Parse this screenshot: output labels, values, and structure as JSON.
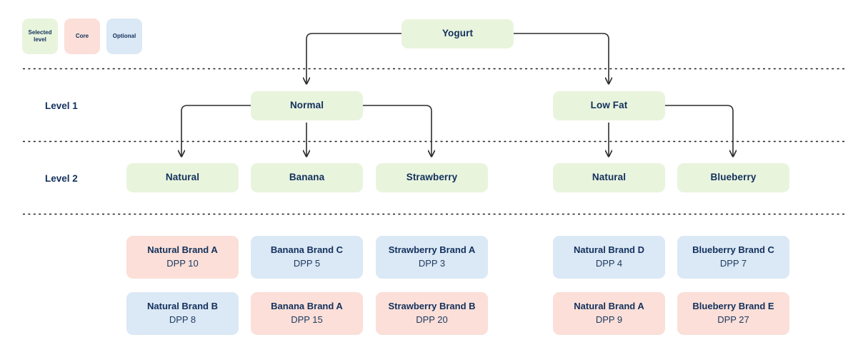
{
  "legend": {
    "items": [
      {
        "label": "Selected level",
        "type": "selected",
        "color": "#e9f4dd"
      },
      {
        "label": "Core",
        "type": "core",
        "color": "#fbdfd8"
      },
      {
        "label": "Optional",
        "type": "optional",
        "color": "#dbe8f5"
      }
    ]
  },
  "row_labels": {
    "level1": "Level 1",
    "level2": "Level 2"
  },
  "root": {
    "label": "Yogurt",
    "type": "selected"
  },
  "level1": [
    {
      "label": "Normal",
      "type": "selected"
    },
    {
      "label": "Low Fat",
      "type": "selected"
    }
  ],
  "level2": [
    {
      "label": "Natural",
      "type": "selected"
    },
    {
      "label": "Banana",
      "type": "selected"
    },
    {
      "label": "Strawberry",
      "type": "selected"
    },
    {
      "label": "Natural",
      "type": "selected"
    },
    {
      "label": "Blueberry",
      "type": "selected"
    }
  ],
  "products": {
    "row1": [
      {
        "title": "Natural Brand A",
        "dpp": "DPP 10",
        "type": "core"
      },
      {
        "title": "Banana Brand C",
        "dpp": "DPP 5",
        "type": "optional"
      },
      {
        "title": "Strawberry Brand A",
        "dpp": "DPP 3",
        "type": "optional"
      },
      {
        "title": "Natural Brand D",
        "dpp": "DPP 4",
        "type": "optional"
      },
      {
        "title": "Blueberry Brand C",
        "dpp": "DPP 7",
        "type": "optional"
      }
    ],
    "row2": [
      {
        "title": "Natural Brand B",
        "dpp": "DPP 8",
        "type": "optional"
      },
      {
        "title": "Banana Brand A",
        "dpp": "DPP 15",
        "type": "core"
      },
      {
        "title": "Strawberry Brand B",
        "dpp": "DPP 20",
        "type": "core"
      },
      {
        "title": "Natural Brand A",
        "dpp": "DPP 9",
        "type": "core"
      },
      {
        "title": "Blueberry Brand E",
        "dpp": "DPP 27",
        "type": "core"
      }
    ]
  },
  "colors": {
    "selected": "#e9f4dd",
    "core": "#fbdfd8",
    "optional": "#dbe8f5",
    "text": "#12305c",
    "connector": "#2d2d2d",
    "divider": "#1b1b1b",
    "background": "#ffffff"
  }
}
